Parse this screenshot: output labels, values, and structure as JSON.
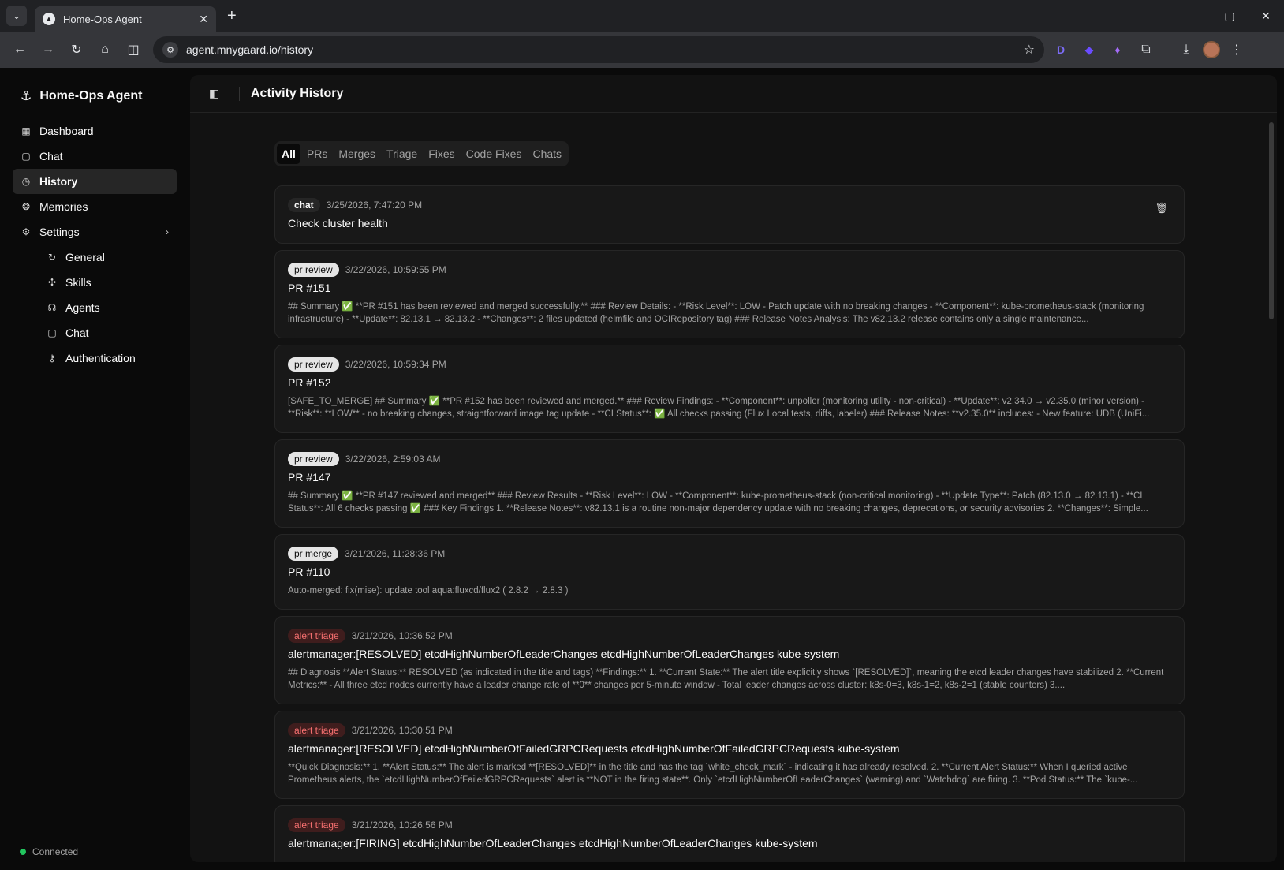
{
  "browser": {
    "tab_title": "Home-Ops Agent",
    "url": "agent.mnygaard.io/history"
  },
  "sidebar": {
    "brand": "Home-Ops Agent",
    "items": [
      {
        "label": "Dashboard",
        "icon": "dashboard-icon"
      },
      {
        "label": "Chat",
        "icon": "chat-icon"
      },
      {
        "label": "History",
        "icon": "history-icon"
      },
      {
        "label": "Memories",
        "icon": "memories-icon"
      },
      {
        "label": "Settings",
        "icon": "gear-icon"
      }
    ],
    "settings_items": [
      {
        "label": "General",
        "icon": "general-icon"
      },
      {
        "label": "Skills",
        "icon": "puzzle-icon"
      },
      {
        "label": "Agents",
        "icon": "bot-icon"
      },
      {
        "label": "Chat",
        "icon": "chat-icon"
      },
      {
        "label": "Authentication",
        "icon": "key-icon"
      }
    ],
    "status": "Connected"
  },
  "header": {
    "title": "Activity History"
  },
  "filters": [
    "All",
    "PRs",
    "Merges",
    "Triage",
    "Fixes",
    "Code Fixes",
    "Chats"
  ],
  "entries": [
    {
      "badge": "chat",
      "date": "3/25/2026, 7:47:20 PM",
      "title": "Check cluster health",
      "body": ""
    },
    {
      "badge": "pr review",
      "date": "3/22/2026, 10:59:55 PM",
      "title": "PR #151",
      "body": "## Summary ✅ **PR #151 has been reviewed and merged successfully.** ### Review Details: - **Risk Level**: LOW - Patch update with no breaking changes - **Component**: kube-prometheus-stack (monitoring infrastructure) - **Update**: 82.13.1 → 82.13.2 - **Changes**: 2 files updated (helmfile and OCIRepository tag) ### Release Notes Analysis: The v82.13.2 release contains only a single maintenance..."
    },
    {
      "badge": "pr review",
      "date": "3/22/2026, 10:59:34 PM",
      "title": "PR #152",
      "body": "[SAFE_TO_MERGE] ## Summary ✅ **PR #152 has been reviewed and merged.** ### Review Findings: - **Component**: unpoller (monitoring utility - non-critical) - **Update**: v2.34.0 → v2.35.0 (minor version) - **Risk**: **LOW** - no breaking changes, straightforward image tag update - **CI Status**: ✅ All checks passing (Flux Local tests, diffs, labeler) ### Release Notes: **v2.35.0** includes: - New feature: UDB (UniFi..."
    },
    {
      "badge": "pr review",
      "date": "3/22/2026, 2:59:03 AM",
      "title": "PR #147",
      "body": "## Summary ✅ **PR #147 reviewed and merged** ### Review Results - **Risk Level**: LOW - **Component**: kube-prometheus-stack (non-critical monitoring) - **Update Type**: Patch (82.13.0 → 82.13.1) - **CI Status**: All 6 checks passing ✅ ### Key Findings 1. **Release Notes**: v82.13.1 is a routine non-major dependency update with no breaking changes, deprecations, or security advisories 2. **Changes**: Simple..."
    },
    {
      "badge": "pr merge",
      "date": "3/21/2026, 11:28:36 PM",
      "title": "PR #110",
      "body": "Auto-merged: fix(mise): update tool aqua:fluxcd/flux2 ( 2.8.2 → 2.8.3 )"
    },
    {
      "badge": "alert triage",
      "date": "3/21/2026, 10:36:52 PM",
      "title": "alertmanager:[RESOLVED] etcdHighNumberOfLeaderChanges etcdHighNumberOfLeaderChanges kube-system",
      "body": "## Diagnosis **Alert Status:** RESOLVED (as indicated in the title and tags) **Findings:** 1. **Current State:** The alert title explicitly shows `[RESOLVED]`, meaning the etcd leader changes have stabilized 2. **Current Metrics:** - All three etcd nodes currently have a leader change rate of **0** changes per 5-minute window - Total leader changes across cluster: k8s-0=3, k8s-1=2, k8s-2=1 (stable counters) 3...."
    },
    {
      "badge": "alert triage",
      "date": "3/21/2026, 10:30:51 PM",
      "title": "alertmanager:[RESOLVED] etcdHighNumberOfFailedGRPCRequests etcdHighNumberOfFailedGRPCRequests kube-system",
      "body": "**Quick Diagnosis:** 1. **Alert Status:** The alert is marked **[RESOLVED]** in the title and has the tag `white_check_mark` - indicating it has already resolved. 2. **Current Alert Status:** When I queried active Prometheus alerts, the `etcdHighNumberOfFailedGRPCRequests` alert is **NOT in the firing state**. Only `etcdHighNumberOfLeaderChanges` (warning) and `Watchdog` are firing. 3. **Pod Status:** The `kube-..."
    },
    {
      "badge": "alert triage",
      "date": "3/21/2026, 10:26:56 PM",
      "title": "alertmanager:[FIRING] etcdHighNumberOfLeaderChanges etcdHighNumberOfLeaderChanges kube-system",
      "body": ""
    }
  ]
}
